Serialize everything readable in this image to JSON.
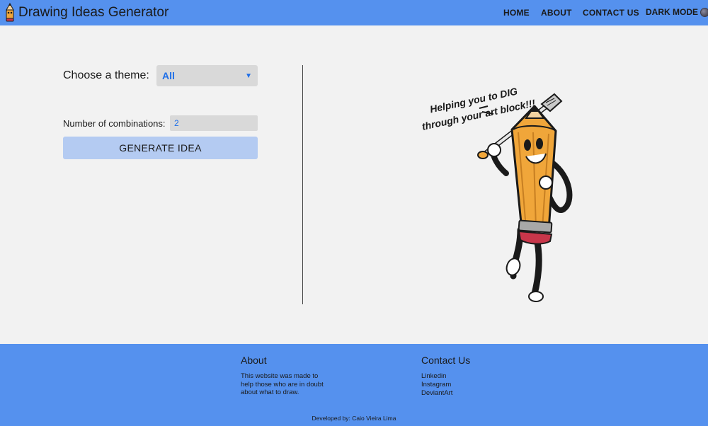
{
  "brand": {
    "title": "Drawing Ideas Generator",
    "logo_icon": "pencil-logo-icon"
  },
  "nav": {
    "home": "HOME",
    "about": "ABOUT",
    "contact": "CONTACT US",
    "dark_mode": "DARK MODE",
    "dark_mode_icon": "moon-icon"
  },
  "form": {
    "theme_label": "Choose a theme:",
    "theme_selected": "All",
    "combinations_label": "Number of combinations:",
    "combinations_value": "2",
    "generate_label": "GENERATE IDEA"
  },
  "illustration": {
    "line1": "Helping you to DIG",
    "line2": "through your art block!!!",
    "icon": "pencil-character-illustration"
  },
  "footer": {
    "about_heading": "About",
    "about_text": "This website was made to help those who are in doubt about what to draw.",
    "contact_heading": "Contact Us",
    "links": [
      "Linkedin",
      "Instagram",
      "DeviantArt"
    ],
    "credit": "Developed by: Caio Vieira Lima"
  },
  "colors": {
    "accent": "#5591ee",
    "background": "#f2f2f2",
    "button": "#b4cbf2",
    "field": "#d9d9d9",
    "field_text": "#1f6fe8"
  }
}
